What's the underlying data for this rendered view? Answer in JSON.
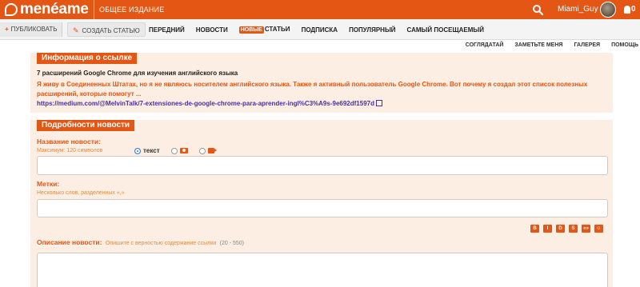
{
  "header": {
    "logo_text": "menéame",
    "subtitle": "ОБЩЕЕ ИЗДАНИЕ",
    "username": "Miami_Guy",
    "notifications": "0"
  },
  "toolbar": {
    "publish_label": "ПУБЛИКОВАТЬ",
    "write_label": "СОЗДАТЬ СТАТЬЮ",
    "tabs": [
      {
        "label": "ПЕРЕДНИЙ"
      },
      {
        "label": "НОВОСТИ"
      },
      {
        "badge": "НОВЫЕ",
        "label": "СТАТЬИ"
      },
      {
        "label": "ПОДПИСКА"
      },
      {
        "label": "ПОПУЛЯРНЫЙ"
      },
      {
        "label": "САМЫЙ ПОСЕЩАЕМЫЙ"
      }
    ]
  },
  "subnav": [
    "СОГЛЯДАТАЙ",
    "ЗАМЕТЬТЕ МЕНЯ",
    "ГАЛЕРЕЯ",
    "ПОМОЩЬ"
  ],
  "link_info": {
    "heading": "Информация о ссылке",
    "title": "7 расширений Google Chrome для изучения английского языка",
    "description": "Я живу в Соединенных Штатах, но я не являюсь носителем английского языка. Также я активный пользователь Google Chrome. Вот почему я создал этот список полезных расширений, которые помогут ...",
    "url": "https://medium.com/@MelvinTalk/7-extensiones-de-google-chrome-para-aprender-ingl%C3%A9s-9e692df1597d"
  },
  "news_details": {
    "heading": "Подробности новости",
    "title_label": "Название новости:",
    "title_hint": "Максимум: 120 символов",
    "type_text_label": "текст",
    "title_value": "",
    "tags_label": "Метки:",
    "tags_hint": "Несколько слов, разделенных «,»",
    "tags_value": "",
    "description_label": "Описание новости:",
    "description_hint": "Опишите с верностью содержание ссылки",
    "description_range": "(20 - 550)",
    "format_buttons": [
      "B",
      "I",
      "D",
      "S",
      "«»",
      "☺"
    ]
  },
  "colors": {
    "brand": "#e35614",
    "panel_bg": "#fdeee3",
    "link": "#4a2fa0"
  }
}
